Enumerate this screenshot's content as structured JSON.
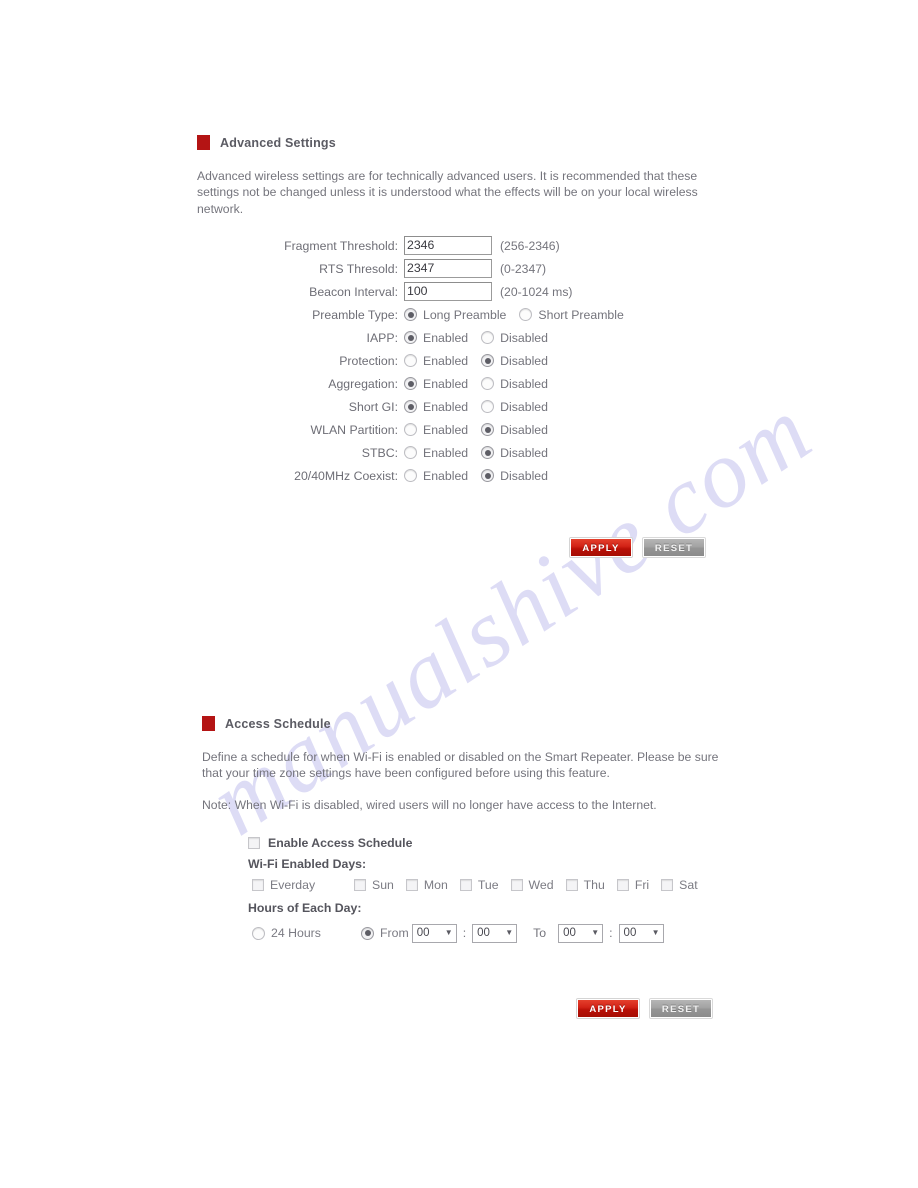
{
  "theme": {
    "marker_color": "#b41414",
    "apply_color": "#c8200f",
    "reset_color": "#9a9a9a",
    "text_color": "#74747c",
    "watermark_color": "#c9c7ef"
  },
  "watermark": {
    "text": "manualshive.com"
  },
  "advanced": {
    "title": "Advanced Settings",
    "description": "Advanced wireless settings are for technically advanced users. It is recommended that these settings not be changed unless it is understood what the effects will be on your local wireless network.",
    "fields": [
      {
        "label": "Fragment Threshold:",
        "value": "2346",
        "hint": "(256-2346)"
      },
      {
        "label": "RTS Thresold:",
        "value": "2347",
        "hint": "(0-2347)"
      },
      {
        "label": "Beacon Interval:",
        "value": "100",
        "hint": "(20-1024 ms)"
      }
    ],
    "preamble": {
      "label": "Preamble Type:",
      "option_a": "Long Preamble",
      "option_b": "Short Preamble",
      "selected": "Long Preamble"
    },
    "toggles": [
      {
        "label": "IAPP:",
        "option_a": "Enabled",
        "option_b": "Disabled",
        "selected": "Enabled"
      },
      {
        "label": "Protection:",
        "option_a": "Enabled",
        "option_b": "Disabled",
        "selected": "Disabled"
      },
      {
        "label": "Aggregation:",
        "option_a": "Enabled",
        "option_b": "Disabled",
        "selected": "Enabled"
      },
      {
        "label": "Short GI:",
        "option_a": "Enabled",
        "option_b": "Disabled",
        "selected": "Enabled"
      },
      {
        "label": "WLAN Partition:",
        "option_a": "Enabled",
        "option_b": "Disabled",
        "selected": "Disabled"
      },
      {
        "label": "STBC:",
        "option_a": "Enabled",
        "option_b": "Disabled",
        "selected": "Disabled"
      },
      {
        "label": "20/40MHz Coexist:",
        "option_a": "Enabled",
        "option_b": "Disabled",
        "selected": "Disabled"
      }
    ],
    "apply_label": "APPLY",
    "reset_label": "RESET"
  },
  "schedule": {
    "title": "Access Schedule",
    "description": "Define a schedule for when Wi-Fi is enabled or disabled on the Smart Repeater. Please be sure that your time zone settings have been configured before using this feature.",
    "note": "Note: When Wi-Fi is disabled, wired users will no longer have access to the Internet.",
    "enable_label": "Enable Access Schedule",
    "enable_checked": false,
    "days_label": "Wi-Fi Enabled Days:",
    "days": [
      {
        "label": "Everday",
        "checked": false
      },
      {
        "label": "Sun",
        "checked": false
      },
      {
        "label": "Mon",
        "checked": false
      },
      {
        "label": "Tue",
        "checked": false
      },
      {
        "label": "Wed",
        "checked": false
      },
      {
        "label": "Thu",
        "checked": false
      },
      {
        "label": "Fri",
        "checked": false
      },
      {
        "label": "Sat",
        "checked": false
      }
    ],
    "hours_label": "Hours of Each Day:",
    "all_day_label": "24 Hours",
    "from_label": "From",
    "to_label": "To",
    "colon": ":",
    "selected_mode": "From",
    "time": {
      "from_hour": "00",
      "from_minute": "00",
      "to_hour": "00",
      "to_minute": "00"
    },
    "caret": "▼",
    "apply_label": "APPLY",
    "reset_label": "RESET"
  }
}
